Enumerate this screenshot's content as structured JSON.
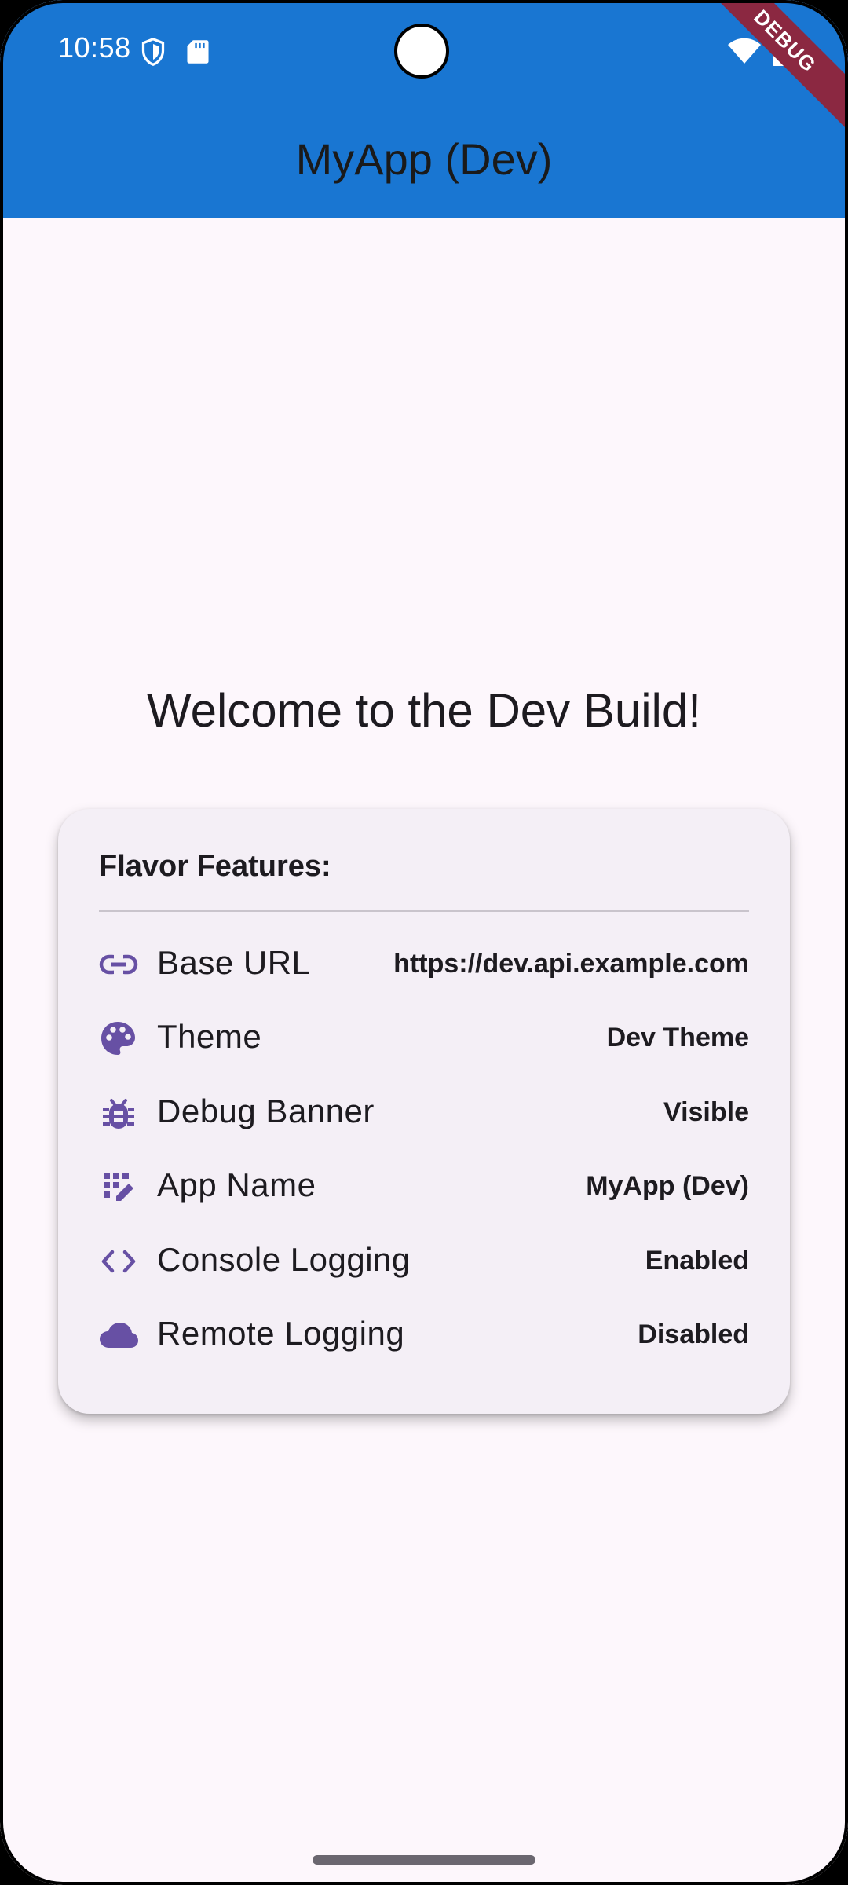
{
  "status_bar": {
    "time": "10:58",
    "icons": [
      "shield-icon",
      "sd-card-icon",
      "wifi-icon",
      "battery-icon"
    ]
  },
  "debug_ribbon": "DEBUG",
  "app_bar": {
    "title": "MyApp (Dev)",
    "color": "#1976D2"
  },
  "welcome": "Welcome to the Dev Build!",
  "card": {
    "title": "Flavor Features:",
    "rows": [
      {
        "icon": "link-icon",
        "label": "Base URL",
        "value": "https://dev.api.example.com"
      },
      {
        "icon": "palette-icon",
        "label": "Theme",
        "value": "Dev Theme"
      },
      {
        "icon": "bug-icon",
        "label": "Debug Banner",
        "value": "Visible"
      },
      {
        "icon": "app-name-icon",
        "label": "App Name",
        "value": "MyApp (Dev)"
      },
      {
        "icon": "code-icon",
        "label": "Console Logging",
        "value": "Enabled"
      },
      {
        "icon": "cloud-icon",
        "label": "Remote Logging",
        "value": "Disabled"
      }
    ]
  },
  "colors": {
    "accent": "#6750A4",
    "background": "#FDF7FC",
    "ribbon": "#8B2841"
  }
}
